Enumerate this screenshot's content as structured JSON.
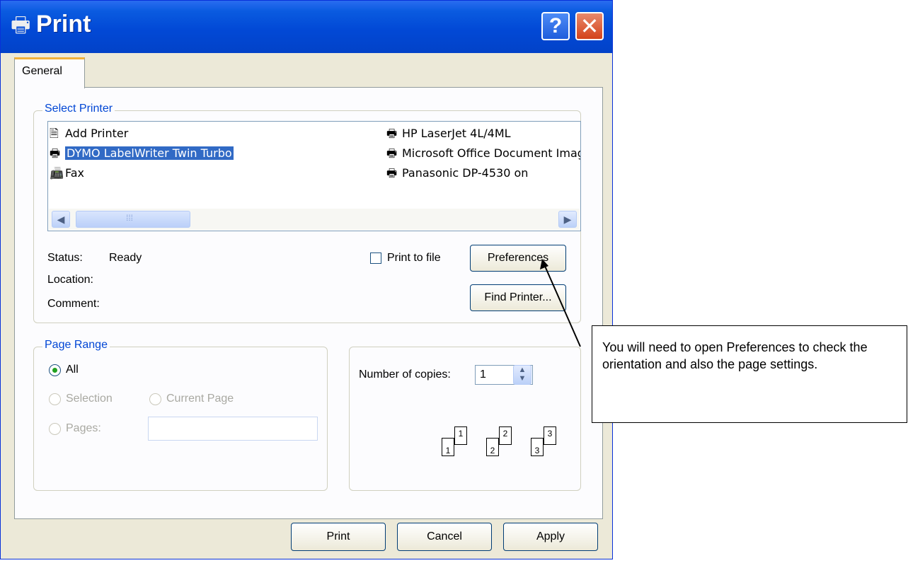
{
  "window": {
    "title": "Print",
    "help_label": "?",
    "close_label": "✕"
  },
  "tabs": [
    {
      "label": "General"
    }
  ],
  "select_printer": {
    "legend": "Select Printer",
    "printers_left": [
      {
        "name": "Add Printer",
        "icon": "add-printer-icon",
        "selected": false
      },
      {
        "name": "DYMO LabelWriter Twin Turbo",
        "icon": "printer-icon",
        "selected": true
      },
      {
        "name": "Fax",
        "icon": "fax-icon",
        "selected": false
      }
    ],
    "printers_right": [
      {
        "name": "HP LaserJet 4L/4ML",
        "icon": "printer-icon"
      },
      {
        "name": "Microsoft Office Document Image Writer",
        "icon": "printer-icon"
      },
      {
        "name": "Panasonic DP-4530 on",
        "icon": "network-printer-icon"
      }
    ],
    "status_label": "Status:",
    "status_value": "Ready",
    "location_label": "Location:",
    "comment_label": "Comment:",
    "print_to_file_label": "Print to file",
    "preferences_label": "Preferences",
    "find_printer_label": "Find Printer..."
  },
  "page_range": {
    "legend": "Page Range",
    "all_label": "All",
    "selection_label": "Selection",
    "current_page_label": "Current Page",
    "pages_label": "Pages:"
  },
  "copies": {
    "label": "Number of copies:",
    "value": "1",
    "collate_pages": [
      "1",
      "1",
      "2",
      "2",
      "3",
      "3"
    ]
  },
  "footer": {
    "print_label": "Print",
    "cancel_label": "Cancel",
    "apply_label": "Apply"
  },
  "callout": {
    "text": "You will need to open Preferences to check the orientation and also the page settings."
  },
  "colors": {
    "titlebar": "#0249d6",
    "tab_accent": "#f0b13b",
    "selection": "#316ac5",
    "legend_text": "#0046d5"
  }
}
